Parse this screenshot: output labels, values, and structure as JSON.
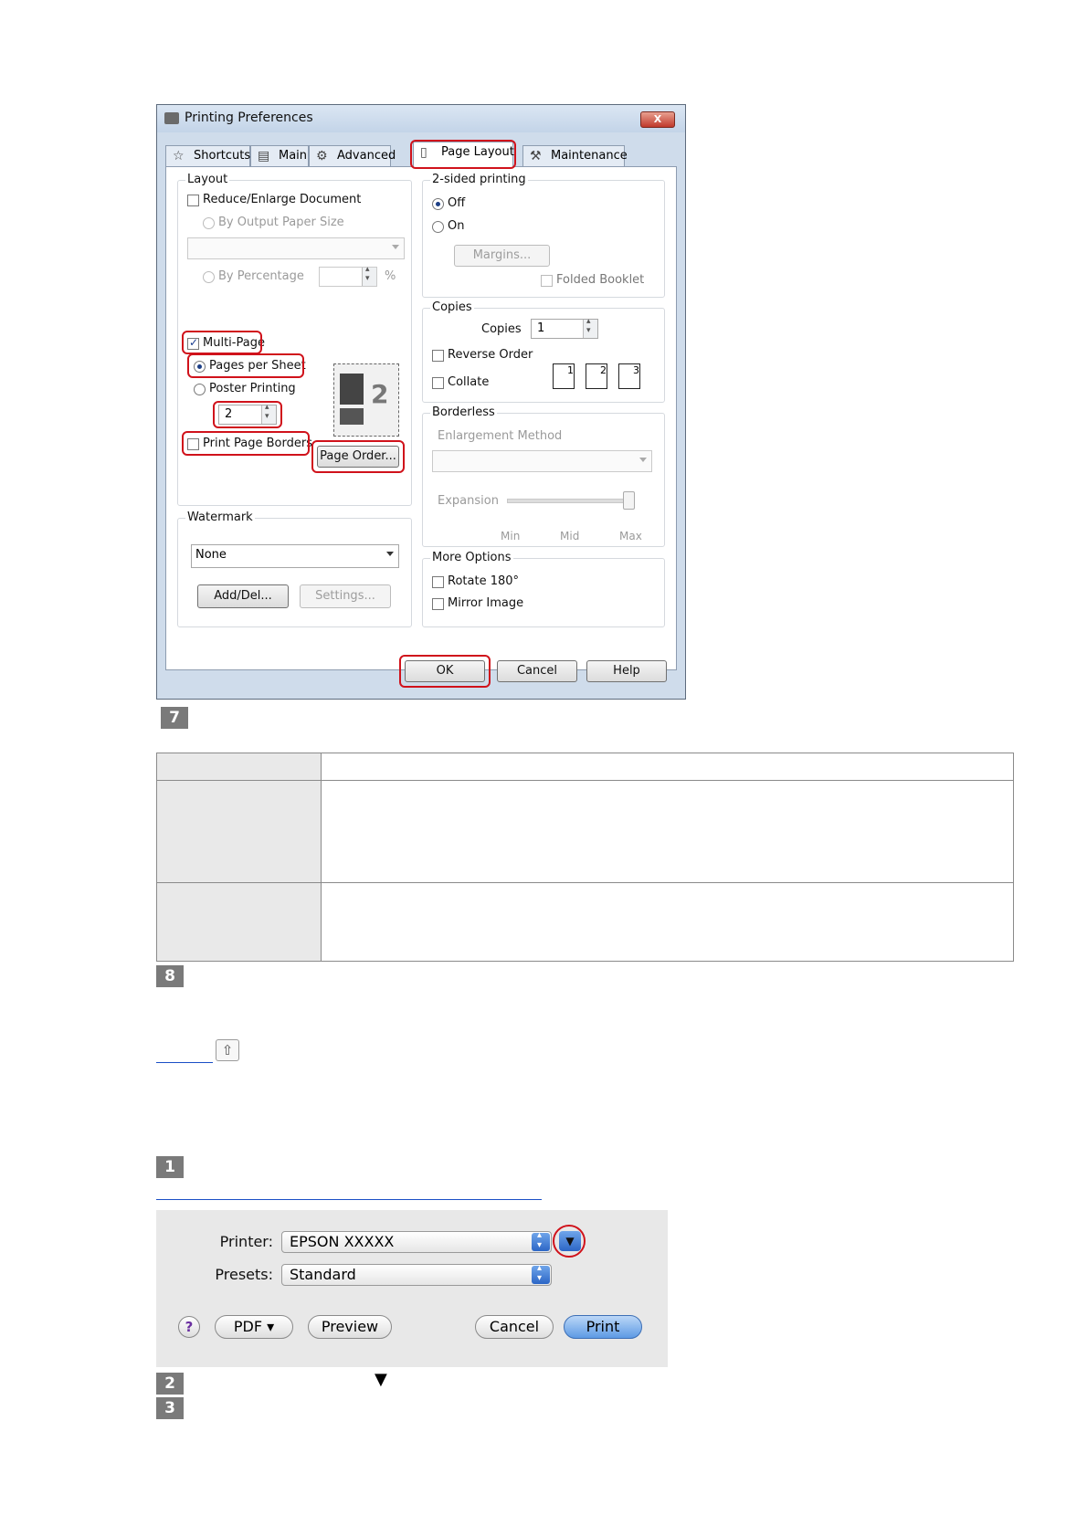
{
  "dialog": {
    "title": "Printing Preferences",
    "close_label": "X",
    "tabs": [
      {
        "label": "Shortcuts",
        "icon": "star-icon"
      },
      {
        "label": "Main",
        "icon": "printer-icon"
      },
      {
        "label": "Advanced",
        "icon": "gear-icon"
      },
      {
        "label": "Page Layout",
        "icon": "page-icon"
      },
      {
        "label": "Maintenance",
        "icon": "wrench-icon"
      }
    ],
    "active_tab": "Page Layout",
    "layout": {
      "group_title": "Layout",
      "reduce_enlarge": "Reduce/Enlarge Document",
      "by_output_paper_size": "By Output Paper Size",
      "by_percentage": "By Percentage",
      "percent_sign": "%",
      "multi_page": "Multi-Page",
      "pages_per_sheet": "Pages per Sheet",
      "poster_printing": "Poster Printing",
      "pages_value": "2",
      "print_page_borders": "Print Page Borders",
      "page_order_button": "Page Order...",
      "preview_number": "2"
    },
    "watermark": {
      "group_title": "Watermark",
      "selected": "None",
      "add_del_button": "Add/Del...",
      "settings_button": "Settings..."
    },
    "two_sided": {
      "group_title": "2-sided printing",
      "off": "Off",
      "on": "On",
      "margins_button": "Margins...",
      "folded_booklet": "Folded Booklet"
    },
    "copies": {
      "group_title": "Copies",
      "copies_label": "Copies",
      "copies_value": "1",
      "reverse_order": "Reverse Order",
      "collate": "Collate",
      "collate_icons": [
        "1",
        "2",
        "3"
      ]
    },
    "borderless": {
      "group_title": "Borderless",
      "enlargement_method": "Enlargement Method",
      "expansion": "Expansion",
      "min": "Min",
      "mid": "Mid",
      "max": "Max"
    },
    "more_options": {
      "group_title": "More Options",
      "rotate": "Rotate 180°",
      "mirror": "Mirror Image"
    },
    "buttons": {
      "ok": "OK",
      "cancel": "Cancel",
      "help": "Help"
    }
  },
  "steps": {
    "s7": "7",
    "s8": "8",
    "s1": "1",
    "s2": "2",
    "s3": "3"
  },
  "mac_dialog": {
    "printer_label": "Printer:",
    "printer_value": "EPSON XXXXX",
    "presets_label": "Presets:",
    "presets_value": "Standard",
    "help_label": "?",
    "pdf_button": "PDF ▾",
    "preview_button": "Preview",
    "cancel_button": "Cancel",
    "print_button": "Print"
  },
  "colors": {
    "highlight": "#d0121b",
    "badge": "#7a7a7a",
    "mac_print": "#5d9ae4"
  }
}
